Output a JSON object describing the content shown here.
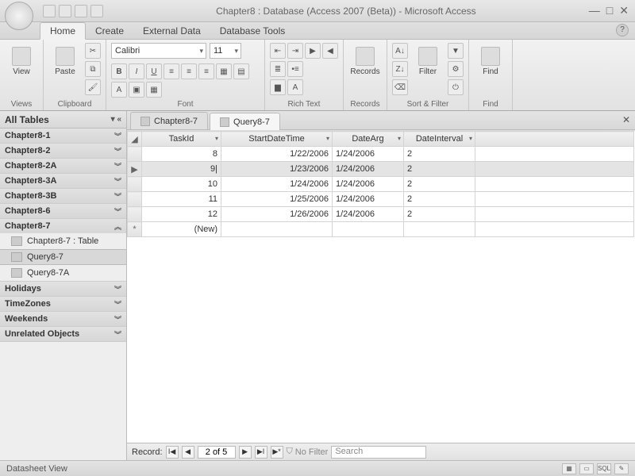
{
  "titlebar": {
    "title": "Chapter8 : Database (Access 2007 (Beta)) - Microsoft Access"
  },
  "ribbon": {
    "tabs": [
      "Home",
      "Create",
      "External Data",
      "Database Tools"
    ],
    "active_tab": "Home",
    "views_group": {
      "label": "Views",
      "view_btn": "View"
    },
    "clipboard_group": {
      "label": "Clipboard",
      "paste_btn": "Paste"
    },
    "font_group": {
      "label": "Font",
      "font_name": "Calibri",
      "font_size": "11"
    },
    "richtext_group": {
      "label": "Rich Text"
    },
    "records_group": {
      "label": "Records",
      "records_btn": "Records"
    },
    "sortfilter_group": {
      "label": "Sort & Filter",
      "filter_btn": "Filter"
    },
    "find_group": {
      "label": "Find",
      "find_btn": "Find"
    }
  },
  "navpane": {
    "header": "All Tables",
    "groups": [
      {
        "name": "Chapter8-1",
        "expanded": false
      },
      {
        "name": "Chapter8-2",
        "expanded": false
      },
      {
        "name": "Chapter8-2A",
        "expanded": false
      },
      {
        "name": "Chapter8-3A",
        "expanded": false
      },
      {
        "name": "Chapter8-3B",
        "expanded": false
      },
      {
        "name": "Chapter8-6",
        "expanded": false
      },
      {
        "name": "Chapter8-7",
        "expanded": true,
        "items": [
          {
            "label": "Chapter8-7 : Table",
            "selected": false
          },
          {
            "label": "Query8-7",
            "selected": true
          },
          {
            "label": "Query8-7A",
            "selected": false
          }
        ]
      },
      {
        "name": "Holidays",
        "expanded": false
      },
      {
        "name": "TimeZones",
        "expanded": false
      },
      {
        "name": "Weekends",
        "expanded": false
      },
      {
        "name": "Unrelated Objects",
        "expanded": false
      }
    ]
  },
  "doctabs": [
    {
      "label": "Chapter8-7",
      "active": false
    },
    {
      "label": "Query8-7",
      "active": true
    }
  ],
  "grid": {
    "columns": [
      "TaskId",
      "StartDateTime",
      "DateArg",
      "DateInterval"
    ],
    "rows": [
      {
        "TaskId": "8",
        "StartDateTime": "1/22/2006",
        "DateArg": "1/24/2006",
        "DateInterval": "2",
        "selected": false
      },
      {
        "TaskId": "9",
        "StartDateTime": "1/23/2006",
        "DateArg": "1/24/2006",
        "DateInterval": "2",
        "selected": true,
        "cursor": true
      },
      {
        "TaskId": "10",
        "StartDateTime": "1/24/2006",
        "DateArg": "1/24/2006",
        "DateInterval": "2",
        "selected": false
      },
      {
        "TaskId": "11",
        "StartDateTime": "1/25/2006",
        "DateArg": "1/24/2006",
        "DateInterval": "2",
        "selected": false
      },
      {
        "TaskId": "12",
        "StartDateTime": "1/26/2006",
        "DateArg": "1/24/2006",
        "DateInterval": "2",
        "selected": false
      }
    ],
    "new_row_label": "(New)"
  },
  "recnav": {
    "label": "Record:",
    "position": "2 of 5",
    "nofilter": "No Filter",
    "search_placeholder": "Search"
  },
  "statusbar": {
    "left": "Datasheet View",
    "sql": "SQL"
  }
}
